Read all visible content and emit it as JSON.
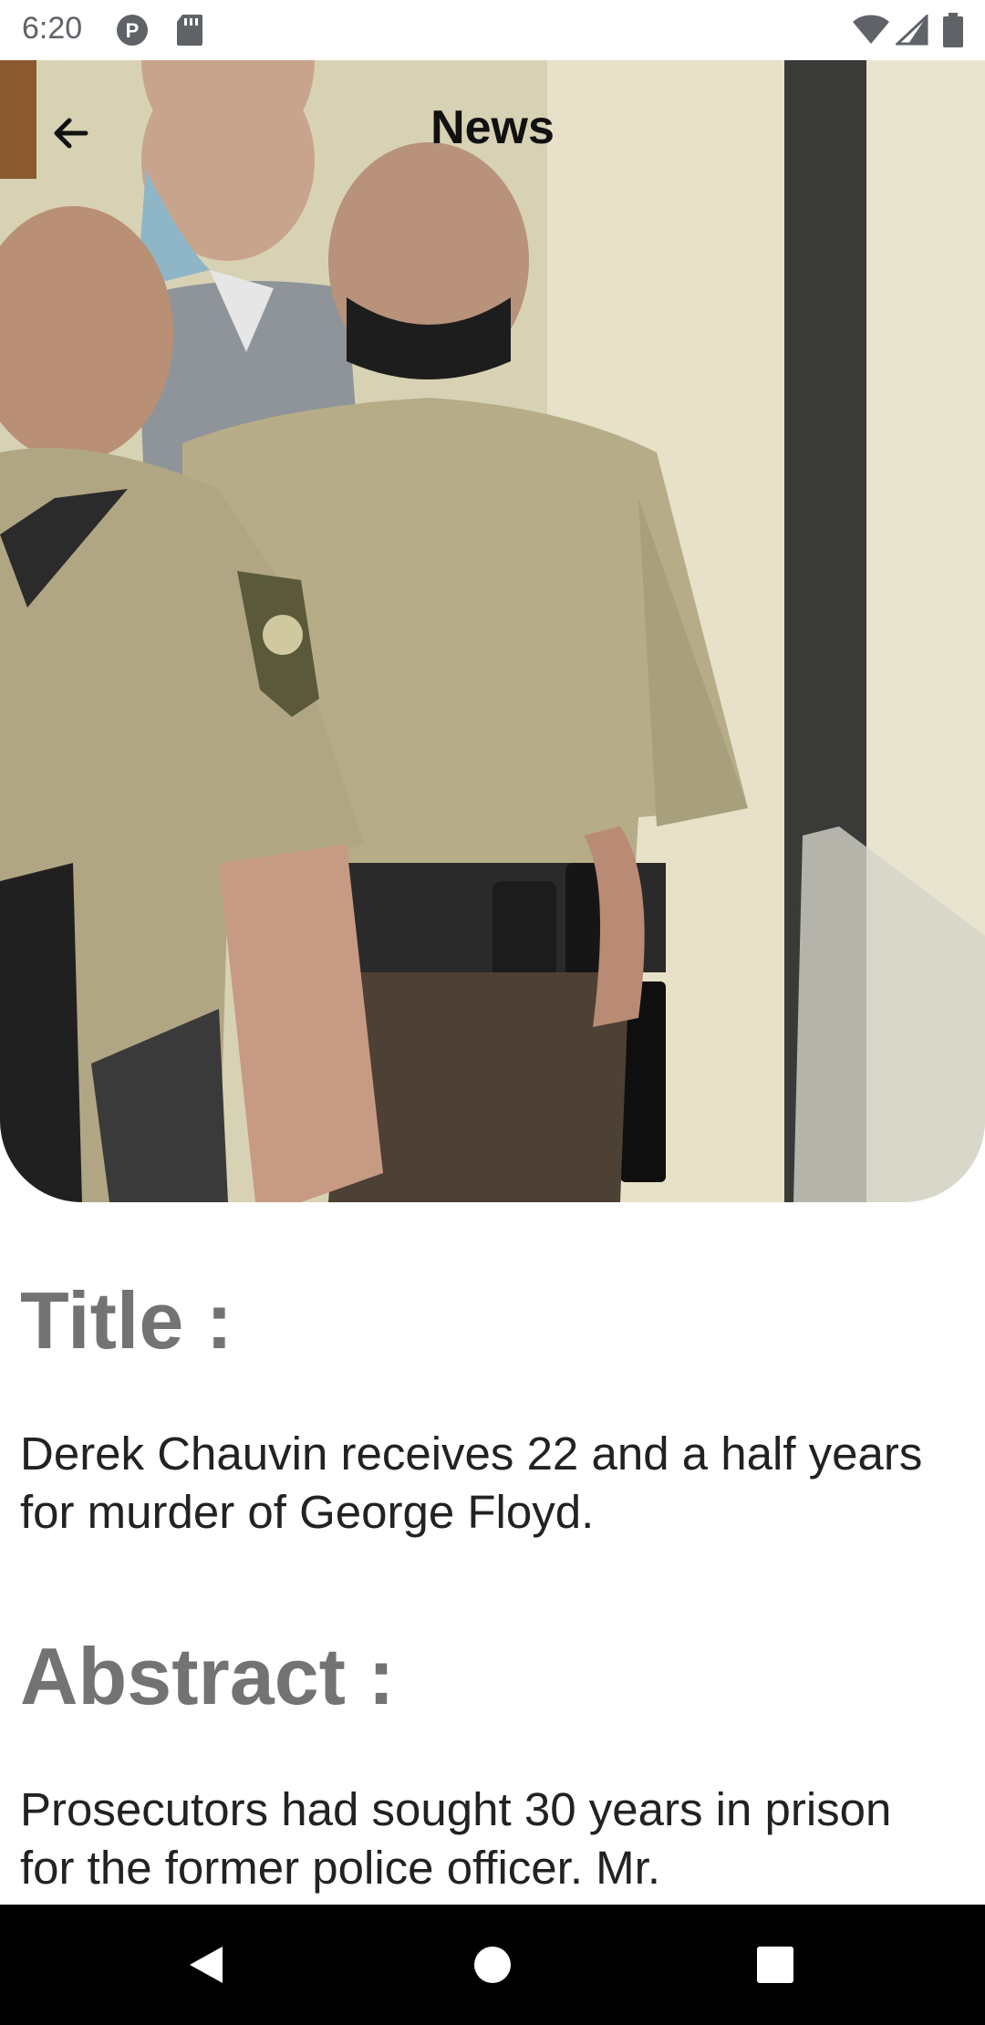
{
  "status_bar": {
    "time": "6:20",
    "icons": [
      "notification-p-icon",
      "sd-card-icon",
      "wifi-icon",
      "signal-icon",
      "battery-icon"
    ]
  },
  "app_bar": {
    "title": "News",
    "back_icon": "arrow-back-icon"
  },
  "hero_image": {
    "description_icon": "news-photo"
  },
  "article": {
    "title_heading": "Title :",
    "title_text": "Derek Chauvin receives 22 and a half years for murder of George Floyd.",
    "abstract_heading": "Abstract :",
    "abstract_text": "Prosecutors had sought 30 years in prison for the former police officer. Mr."
  },
  "nav_bar": {
    "buttons": [
      "back-triangle-icon",
      "home-circle-icon",
      "recents-square-icon"
    ]
  },
  "colors": {
    "heading_gray": "#737373",
    "body_text": "#222222",
    "nav_bar": "#000000"
  }
}
